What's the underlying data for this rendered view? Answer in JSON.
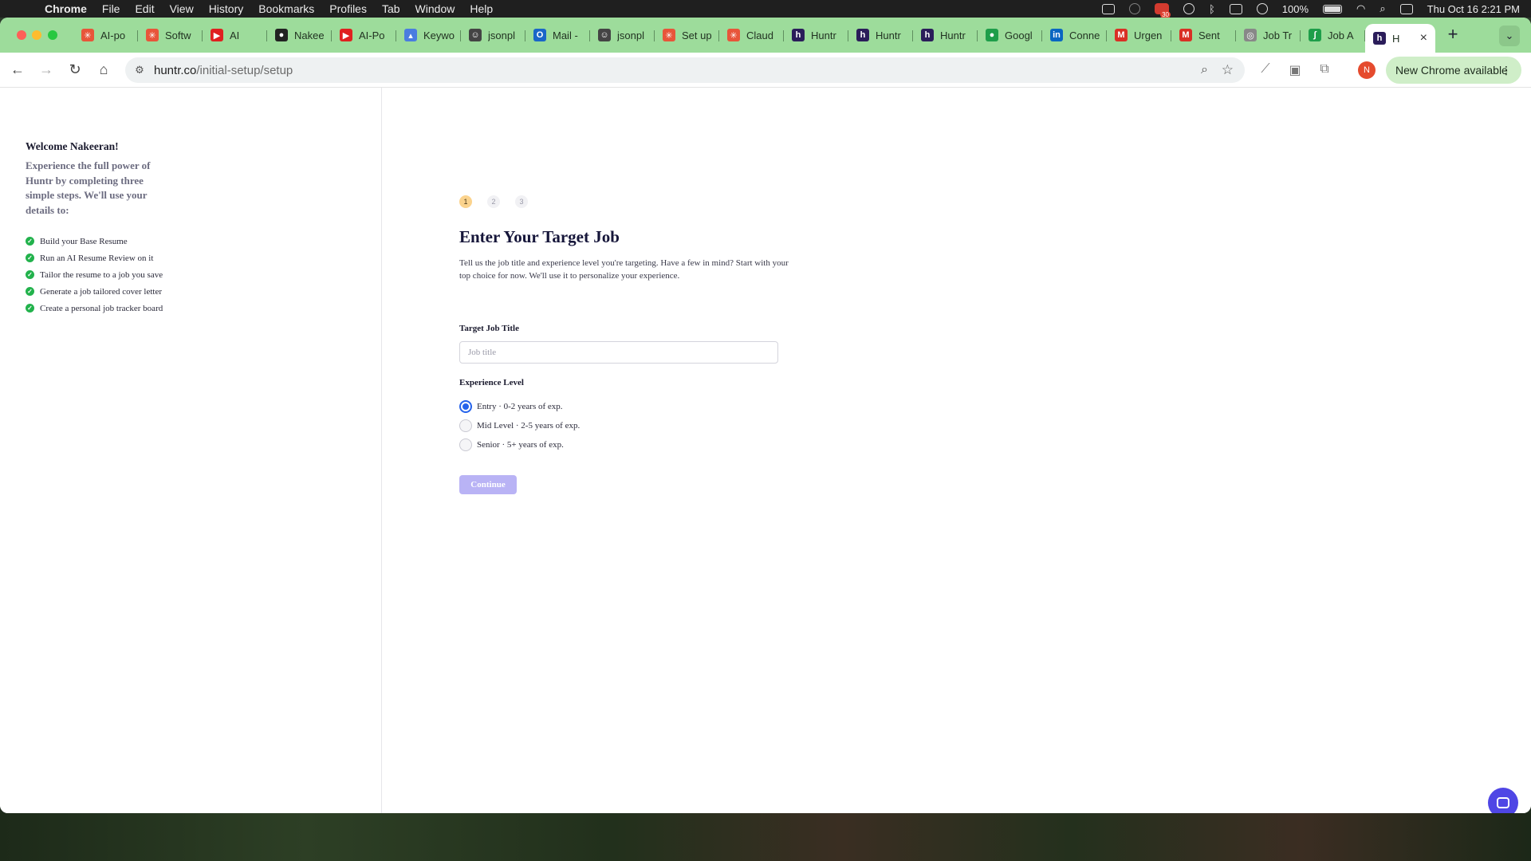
{
  "menubar": {
    "app": "Chrome",
    "items": [
      "File",
      "Edit",
      "View",
      "History",
      "Bookmarks",
      "Profiles",
      "Tab",
      "Window",
      "Help"
    ],
    "battery": "100%",
    "datetime": "Thu Oct 16  2:21 PM",
    "badge_count": "30"
  },
  "tabs": [
    {
      "label": "AI-po",
      "icon": "asterisk-icon",
      "color": "#e8553a"
    },
    {
      "label": "Softw",
      "icon": "asterisk-icon",
      "color": "#e8553a"
    },
    {
      "label": "AI",
      "icon": "youtube-icon",
      "color": "#e02020"
    },
    {
      "label": "Nakee",
      "icon": "github-icon",
      "color": "#222222"
    },
    {
      "label": "AI-Po",
      "icon": "youtube-icon",
      "color": "#e02020"
    },
    {
      "label": "Keywo",
      "icon": "chart-icon",
      "color": "#4a7de0"
    },
    {
      "label": "jsonpl",
      "icon": "robot-icon",
      "color": "#444444"
    },
    {
      "label": "Mail -",
      "icon": "outlook-icon",
      "color": "#1a66c8"
    },
    {
      "label": "jsonpl",
      "icon": "robot-icon",
      "color": "#444444"
    },
    {
      "label": "Set up",
      "icon": "asterisk-icon",
      "color": "#e8553a"
    },
    {
      "label": "Claud",
      "icon": "asterisk-icon",
      "color": "#e8553a"
    },
    {
      "label": "Huntr",
      "icon": "huntr-icon",
      "color": "#2b1d5a"
    },
    {
      "label": "Huntr",
      "icon": "huntr-icon",
      "color": "#2b1d5a"
    },
    {
      "label": "Huntr",
      "icon": "huntr-icon",
      "color": "#2b1d5a"
    },
    {
      "label": "Googl",
      "icon": "maps-pin-icon",
      "color": "#1e9e4a"
    },
    {
      "label": "Conne",
      "icon": "linkedin-icon",
      "color": "#0a66c2"
    },
    {
      "label": "Urgen",
      "icon": "gmail-icon",
      "color": "#d93025"
    },
    {
      "label": "Sent",
      "icon": "gmail-icon",
      "color": "#d93025"
    },
    {
      "label": "Job Tr",
      "icon": "globe-icon",
      "color": "#888888"
    },
    {
      "label": "Job A",
      "icon": "leaf-icon",
      "color": "#1e9e4a"
    },
    {
      "label": "H",
      "icon": "huntr-icon",
      "color": "#2b1d5a",
      "active": true
    }
  ],
  "toolbar": {
    "url_host": "huntr.co",
    "url_path": "/initial-setup/setup",
    "profile_initial": "N",
    "new_chrome_label": "New Chrome available"
  },
  "sidebar": {
    "welcome_title": "Welcome Nakeeran!",
    "welcome_body": "Experience the full power of Huntr by completing three simple steps. We'll use your details to:",
    "features": [
      "Build your Base Resume",
      "Run an AI Resume Review on it",
      "Tailor the resume to a job you save",
      "Generate a job tailored cover letter",
      "Create a personal job tracker board"
    ]
  },
  "main": {
    "steps": [
      "1",
      "2",
      "3"
    ],
    "active_step": 1,
    "title": "Enter Your Target Job",
    "description": "Tell us the job title and experience level you're targeting. Have a few in mind? Start with your top choice for now. We'll use it to personalize your experience.",
    "job_title_label": "Target Job Title",
    "job_title_placeholder": "Job title",
    "job_title_value": "",
    "experience_label": "Experience Level",
    "experience_options": [
      {
        "label": "Entry · 0-2 years of exp.",
        "checked": true
      },
      {
        "label": "Mid Level · 2-5 years of exp.",
        "checked": false
      },
      {
        "label": "Senior · 5+ years of exp.",
        "checked": false
      }
    ],
    "continue_label": "Continue"
  },
  "colors": {
    "tabstrip": "#9ddc9b",
    "accent_blue": "#2563eb",
    "continue_button": "#b9b3f5",
    "check_green": "#22b24c",
    "chat_bubble": "#4f46e5"
  }
}
